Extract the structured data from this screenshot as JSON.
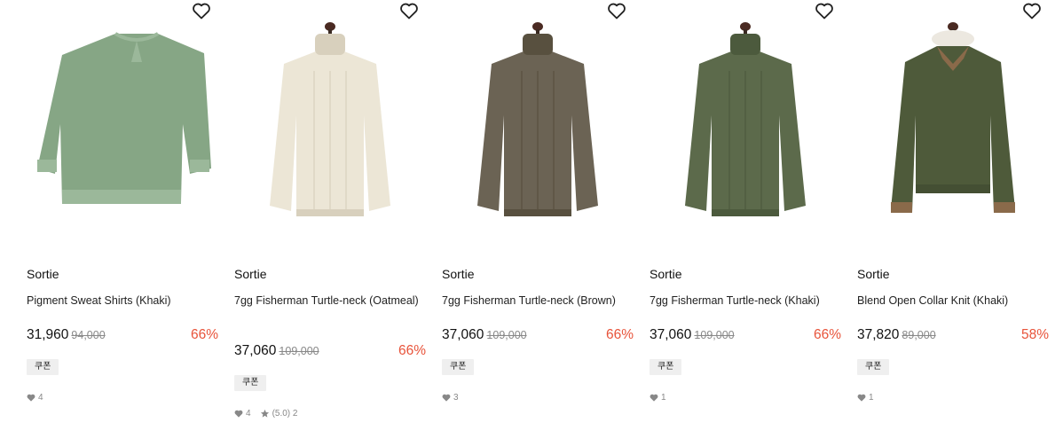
{
  "products": [
    {
      "brand": "Sortie",
      "title": "Pigment Sweat Shirts (Khaki)",
      "price": "31,960",
      "original_price": "94,000",
      "discount": "66%",
      "coupon": "쿠폰",
      "likes": "4",
      "rating": "",
      "reviews": "",
      "garment": "crewneck",
      "color": "#86a685",
      "accent": "#9bb89a"
    },
    {
      "brand": "Sortie",
      "title": "7gg Fisherman Turtle-neck (Oatmeal)",
      "price": "37,060",
      "original_price": "109,000",
      "discount": "66%",
      "coupon": "쿠폰",
      "likes": "4",
      "rating": "(5.0)",
      "reviews": "2",
      "garment": "turtleneck",
      "color": "#ece6d6",
      "accent": "#d8d0bd"
    },
    {
      "brand": "Sortie",
      "title": "7gg Fisherman Turtle-neck (Brown)",
      "price": "37,060",
      "original_price": "109,000",
      "discount": "66%",
      "coupon": "쿠폰",
      "likes": "3",
      "rating": "",
      "reviews": "",
      "garment": "turtleneck",
      "color": "#6b6354",
      "accent": "#58503f"
    },
    {
      "brand": "Sortie",
      "title": "7gg Fisherman Turtle-neck (Khaki)",
      "price": "37,060",
      "original_price": "109,000",
      "discount": "66%",
      "coupon": "쿠폰",
      "likes": "1",
      "rating": "",
      "reviews": "",
      "garment": "turtleneck",
      "color": "#5c6a4b",
      "accent": "#4c5a3d"
    },
    {
      "brand": "Sortie",
      "title": "Blend Open Collar Knit (Khaki)",
      "price": "37,820",
      "original_price": "89,000",
      "discount": "58%",
      "coupon": "쿠폰",
      "likes": "1",
      "rating": "",
      "reviews": "",
      "garment": "polo",
      "color": "#4e5a3a",
      "accent": "#8a6a4a"
    }
  ]
}
